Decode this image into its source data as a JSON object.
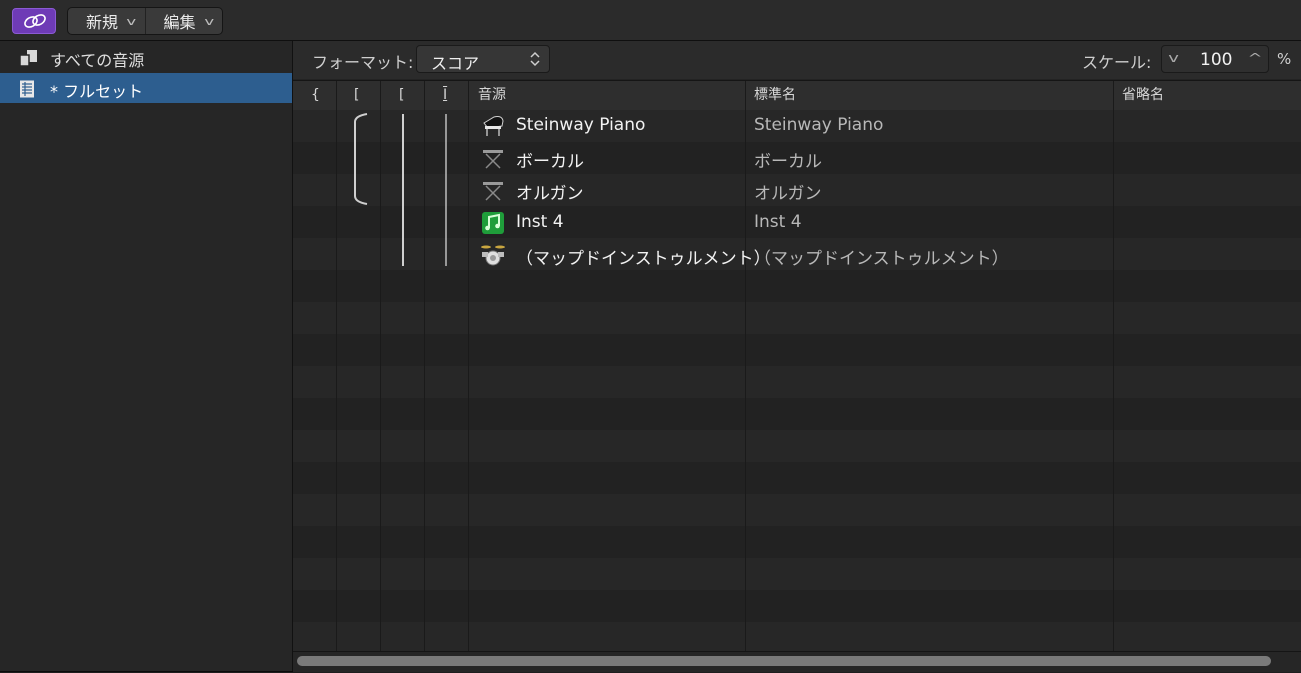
{
  "toolbar": {
    "new_label": "新規",
    "edit_label": "編集"
  },
  "sidebar": {
    "items": [
      {
        "label": "すべての音源",
        "icon": "library-icon",
        "selected": false
      },
      {
        "label": "* フルセット",
        "icon": "score-set-icon",
        "selected": true
      }
    ]
  },
  "header": {
    "format_label": "フォーマット:",
    "format_value": "スコア",
    "scale_label": "スケール:",
    "scale_value": "100",
    "scale_unit": "%"
  },
  "columns": {
    "brace": "{",
    "bracket": "[",
    "subbracket": "[",
    "barline": "I",
    "instrument": "音源",
    "full_name": "標準名",
    "short_name": "省略名"
  },
  "rows": [
    {
      "name": "Steinway Piano",
      "full_name": "Steinway Piano",
      "icon": "grand-piano-icon"
    },
    {
      "name": "ボーカル",
      "full_name": "ボーカル",
      "icon": "keyboard-stand-icon"
    },
    {
      "name": "オルガン",
      "full_name": "オルガン",
      "icon": "keyboard-stand-icon"
    },
    {
      "name": "Inst 4",
      "full_name": "Inst 4",
      "icon": "music-note-icon"
    },
    {
      "name": "（マップドインストゥルメント）",
      "full_name": "（マップドインストゥルメント）",
      "icon": "drum-kit-icon"
    }
  ],
  "colors": {
    "accent_purple": "#6e3bb6",
    "selection_blue": "#2d5e8f",
    "inst_green": "#1f9d3a"
  }
}
